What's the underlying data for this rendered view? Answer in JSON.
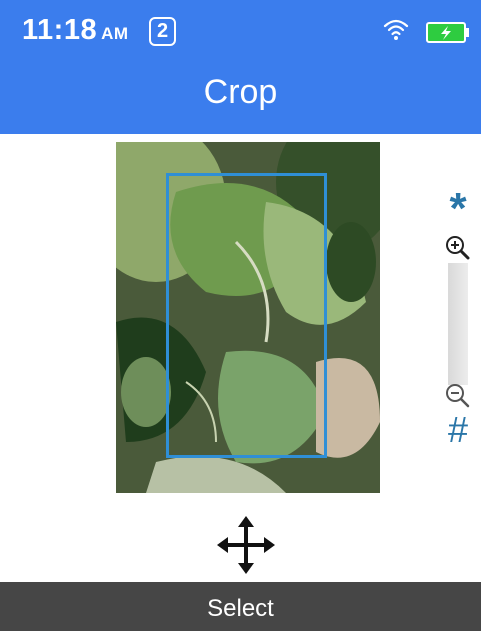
{
  "status_bar": {
    "time": "11:18",
    "ampm": "AM",
    "notification_count": "2",
    "wifi_icon": "wifi-icon",
    "battery_icon": "battery-charging-icon"
  },
  "header": {
    "title": "Crop",
    "background_color": "#3b7ded"
  },
  "editor": {
    "image_description_icon": "photo-leaves",
    "crop_frame_color": "#2f8fd6"
  },
  "zoom": {
    "top_glyph": "*",
    "bottom_glyph": "#",
    "zoom_in_icon": "zoom-in-icon",
    "zoom_out_icon": "zoom-out-icon",
    "accent_color": "#2a76a8"
  },
  "move_icon": "move-arrows-icon",
  "softkeys": {
    "center_label": "Select"
  }
}
